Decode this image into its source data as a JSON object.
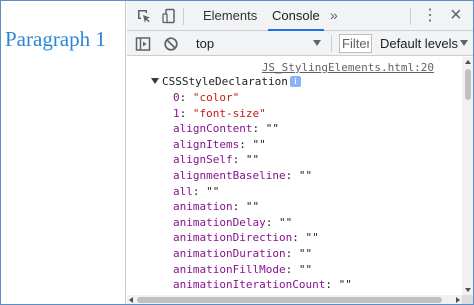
{
  "page": {
    "paragraph": "Paragraph 1"
  },
  "devtools": {
    "tabs": [
      {
        "label": "Elements",
        "active": false
      },
      {
        "label": "Console",
        "active": true
      }
    ],
    "more_tabs": "»",
    "icons": {
      "inspect": "inspect-element-icon",
      "device": "device-toolbar-icon",
      "sidebar": "console-sidebar-icon",
      "clear": "clear-console-icon",
      "menu": "kebab-menu-icon",
      "close": "close-icon"
    },
    "close_glyph": "×",
    "menu_glyph": "⋮"
  },
  "toolbar": {
    "context": "top",
    "filter_placeholder": "Filter",
    "levels": "Default levels"
  },
  "console": {
    "source_link": "JS_StylingElements.html:20",
    "object_name": "CSSStyleDeclaration",
    "info_badge": "i",
    "properties": [
      {
        "key": "0",
        "value": "\"color\"",
        "string": true
      },
      {
        "key": "1",
        "value": "\"font-size\"",
        "string": true
      },
      {
        "key": "alignContent",
        "value": "\"\"",
        "string": false
      },
      {
        "key": "alignItems",
        "value": "\"\"",
        "string": false
      },
      {
        "key": "alignSelf",
        "value": "\"\"",
        "string": false
      },
      {
        "key": "alignmentBaseline",
        "value": "\"\"",
        "string": false
      },
      {
        "key": "all",
        "value": "\"\"",
        "string": false
      },
      {
        "key": "animation",
        "value": "\"\"",
        "string": false
      },
      {
        "key": "animationDelay",
        "value": "\"\"",
        "string": false
      },
      {
        "key": "animationDirection",
        "value": "\"\"",
        "string": false
      },
      {
        "key": "animationDuration",
        "value": "\"\"",
        "string": false
      },
      {
        "key": "animationFillMode",
        "value": "\"\"",
        "string": false
      },
      {
        "key": "animationIterationCount",
        "value": "\"\"",
        "string": false
      }
    ]
  },
  "colors": {
    "paragraph": "#2a86d8",
    "property_key": "#881391",
    "string_value": "#c41a16",
    "active_tab_underline": "#1a73e8"
  }
}
